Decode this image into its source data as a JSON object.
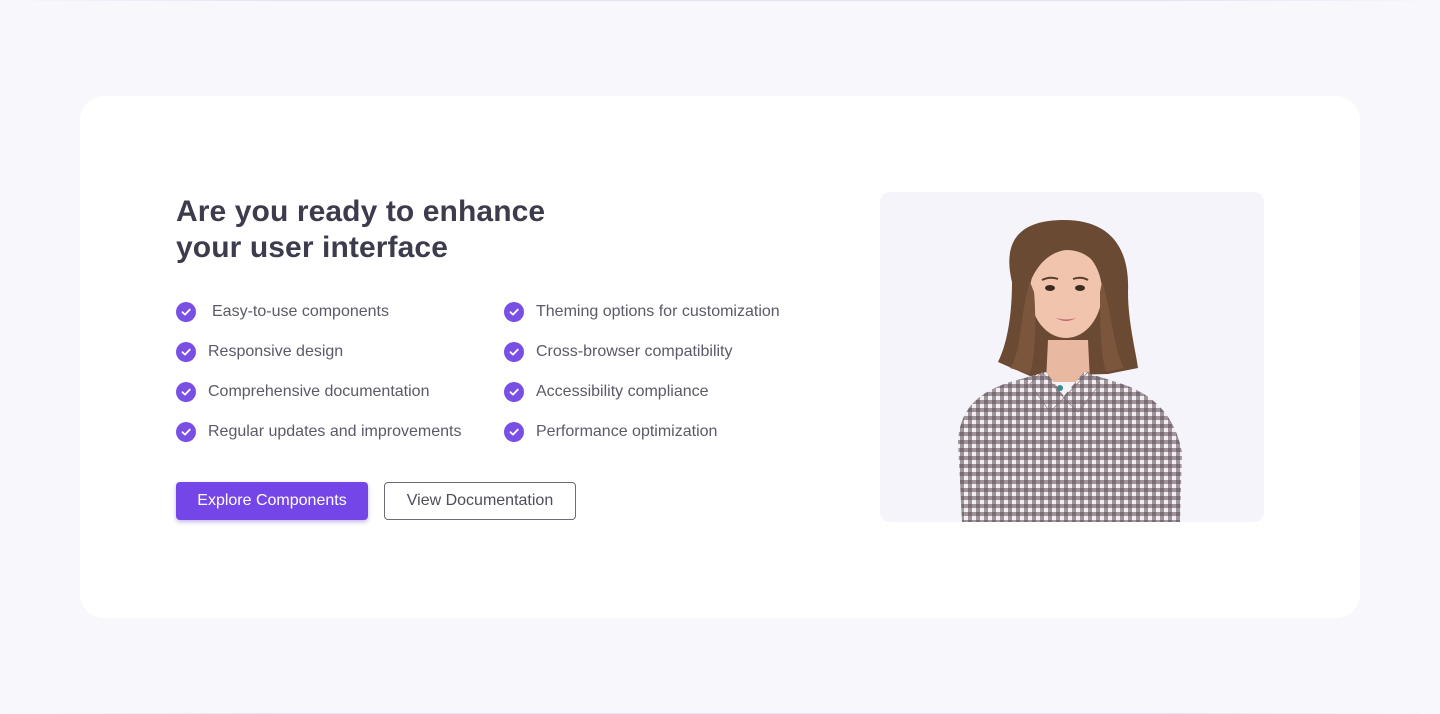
{
  "cta": {
    "heading_line1": "Are you ready to enhance",
    "heading_line2": "your user interface",
    "features_left": [
      "Easy-to-use components",
      "Responsive design",
      "Comprehensive documentation",
      "Regular updates and improvements"
    ],
    "features_right": [
      "Theming options for customization",
      "Cross-browser compatibility",
      "Accessibility compliance",
      "Performance optimization"
    ],
    "primary_button": "Explore Components",
    "secondary_button": "View Documentation"
  },
  "colors": {
    "accent": "#7446e8",
    "page_background": "#f8f7fc",
    "card_background": "#ffffff",
    "heading_text": "#3c3c4c",
    "body_text": "#5a5a68"
  },
  "icons": {
    "feature_bullet": "check-circle-icon"
  }
}
